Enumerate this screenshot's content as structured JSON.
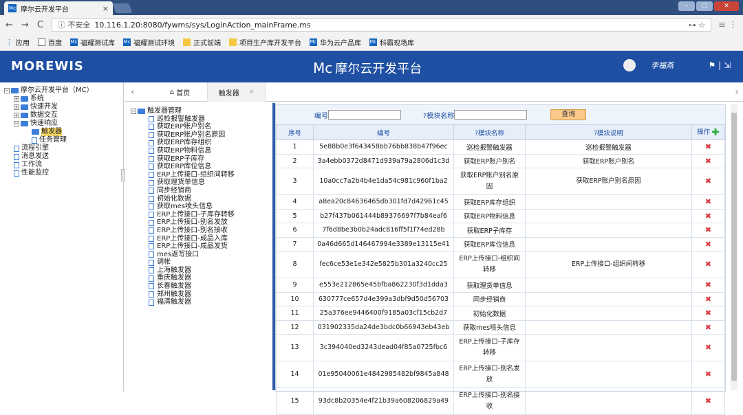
{
  "browser": {
    "tab_title": "摩尔云开发平台",
    "tab_favicon": "Mc",
    "nav_back": "←",
    "nav_forward": "→",
    "nav_reload": "C",
    "insecure": "ⓘ 不安全",
    "url": "10.116.1.20:8080/fywms/sys/LoginAction_mainFrame.ms",
    "right_icons": "⊶ ☆",
    "menu_icon": "≡ ⋮"
  },
  "bookmarks": [
    {
      "icon": "apps",
      "label": "应用"
    },
    {
      "icon": "page",
      "label": "百度"
    },
    {
      "icon": "mc",
      "label": "福耀测试库"
    },
    {
      "icon": "mc",
      "label": "福耀测试环境"
    },
    {
      "icon": "folder",
      "label": "正式前端"
    },
    {
      "icon": "folder",
      "label": "项目生产库开发平台"
    },
    {
      "icon": "mc",
      "label": "华为云产品库"
    },
    {
      "icon": "mc",
      "label": "科霸现场库"
    }
  ],
  "header": {
    "logo": "MOREWIS",
    "title_mark": "Mc",
    "title": "摩尔云开发平台",
    "user": "李福燕",
    "icons": "⚑ | ⇲"
  },
  "sidebar": {
    "root": "摩尔云开发平台（MC）",
    "items": [
      {
        "label": "系统",
        "type": "folder",
        "lvl": 1,
        "pm": "+"
      },
      {
        "label": "快速开发",
        "type": "folder",
        "lvl": 1,
        "pm": "+"
      },
      {
        "label": "数据交互",
        "type": "folder",
        "lvl": 1,
        "pm": "+"
      },
      {
        "label": "快速响应",
        "type": "folder",
        "lvl": 1,
        "pm": "−"
      },
      {
        "label": "触发器",
        "type": "folder",
        "lvl": 2,
        "sel": true
      },
      {
        "label": "任务管理",
        "type": "doc",
        "lvl": 2
      },
      {
        "label": "流程引擎",
        "type": "doc",
        "lvl": 1
      },
      {
        "label": "消息发送",
        "type": "doc",
        "lvl": 1
      },
      {
        "label": "工作流",
        "type": "doc",
        "lvl": 1
      },
      {
        "label": "性能监控",
        "type": "doc",
        "lvl": 1
      }
    ]
  },
  "tabs": {
    "home": "首页",
    "active": "触发器",
    "close": "×"
  },
  "trigger_tree": {
    "root": "触发器管理",
    "items": [
      "巡检报警触发器",
      "获取ERP账户别名",
      "获取ERP账户别名原因",
      "获取ERP库存组织",
      "获取ERP物料信息",
      "获取ERP子库存",
      "获取ERP库位信息",
      "ERP上传接口-组织间转移",
      "获取理货单信息",
      "同步经销商",
      "初始化数据",
      "获取mes喷头信息",
      "ERP上传接口-子库存转移",
      "ERP上传接口-别名发放",
      "ERP上传接口-别名接收",
      "ERP上传接口-成品入库",
      "ERP上传接口-成品发货",
      "mes返写接口",
      "调帐",
      "上海触发器",
      "重庆触发器",
      "长春触发器",
      "郑州触发器",
      "福清触发器"
    ]
  },
  "search": {
    "code_label": "编号",
    "name_label": "?模块名称",
    "query_button": "查询"
  },
  "table": {
    "headers": [
      "序号",
      "编号",
      "?模块名称",
      "?模块说明",
      "操作"
    ],
    "rows": [
      [
        "1",
        "5e88b0e3f643458bb76bb838b47f96ec",
        "巡检报警触发器",
        "巡检报警触发器"
      ],
      [
        "2",
        "3a4ebb0372d8471d939a79a2806d1c3d",
        "获取ERP账户别名",
        "获取ERP账户别名"
      ],
      [
        "3",
        "10a0cc7a2b4b4e1da54c981c960f1ba2",
        "获取ERP账户别名原因",
        "获取ERP账户别名原因"
      ],
      [
        "4",
        "a8ea20c84636465db301fd7d42961c45",
        "获取ERP库存组织",
        ""
      ],
      [
        "5",
        "b27f437b061444b89376697f7b84eaf6",
        "获取ERP物料信息",
        ""
      ],
      [
        "6",
        "7f6d8be3b0b24adc816ff5f1f74ed28b",
        "获取ERP子库存",
        ""
      ],
      [
        "7",
        "0a46d665d146467994e3389e13115e41",
        "获取ERP库位信息",
        ""
      ],
      [
        "8",
        "fec6ce53e1e342e5825b301a3240cc25",
        "ERP上传接口-组织间转移",
        "ERP上传接口-组织间转移"
      ],
      [
        "9",
        "e553e212865e45bfba862230f3d1dda3",
        "获取理货单信息",
        ""
      ],
      [
        "10",
        "630777ce657d4e399a3dbf9d50d56703",
        "同步经销商",
        ""
      ],
      [
        "11",
        "25a376ee9446400f9185a03cf15cb2d7",
        "初始化数据",
        ""
      ],
      [
        "12",
        "031902335da24de3bdc0b66943eb43eb",
        "获取mes喷头信息",
        ""
      ],
      [
        "13",
        "3c394040ed3243dead04f85a0725fbc6",
        "ERP上传接口-子库存转移",
        ""
      ],
      [
        "14",
        "01e95040061e4842985482bf9845a848",
        "ERP上传接口-别名发放",
        ""
      ],
      [
        "15",
        "93dc8b20354e4f21b39a608206829a49",
        "ERP上传接口-别名接收",
        ""
      ]
    ],
    "delete_glyph": "✖",
    "add_glyph": "✚"
  }
}
